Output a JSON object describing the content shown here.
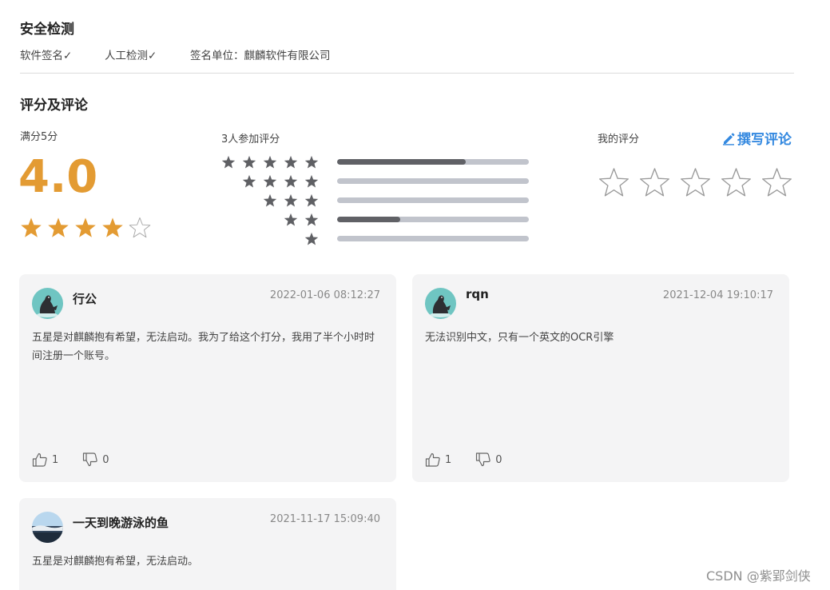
{
  "security": {
    "title": "安全检测",
    "items": [
      "软件签名✓",
      "人工检测✓",
      "签名单位：麒麟软件有限公司"
    ]
  },
  "rating": {
    "title": "评分及评论",
    "max_label": "满分5分",
    "score": "4.0",
    "score_value": 4,
    "participants_label": "3人参加评分",
    "distribution": [
      {
        "stars": 5,
        "fraction": 0.67
      },
      {
        "stars": 4,
        "fraction": 0
      },
      {
        "stars": 3,
        "fraction": 0
      },
      {
        "stars": 2,
        "fraction": 0.33
      },
      {
        "stars": 1,
        "fraction": 0
      }
    ],
    "my_rating_label": "我的评分",
    "my_rating_value": 0,
    "write_review_label": "撰写评论"
  },
  "reviews": [
    {
      "name": "行公",
      "date": "2022-01-06 08:12:27",
      "text": "五星是对麒麟抱有希望，无法启动。我为了给这个打分，我用了半个小时时间注册一个账号。",
      "likes": "1",
      "dislikes": "0",
      "avatar": "seal-avatar"
    },
    {
      "name": "rqn",
      "date": "2021-12-04 19:10:17",
      "text": "无法识别中文，只有一个英文的OCR引擎",
      "likes": "1",
      "dislikes": "0",
      "avatar": "seal-avatar"
    },
    {
      "name": "一天到晚游泳的鱼",
      "date": "2021-11-17 15:09:40",
      "text": "五星是对麒麟抱有希望，无法启动。",
      "avatar": "landscape-avatar"
    }
  ],
  "watermark": "CSDN @紫郢剑侠",
  "colors": {
    "accent": "#e39b33",
    "link": "#3489e0",
    "bar_fill": "#606166",
    "bar_track": "#c1c4cc",
    "star_dark": "#5f6064",
    "card_bg": "#f4f4f5"
  }
}
